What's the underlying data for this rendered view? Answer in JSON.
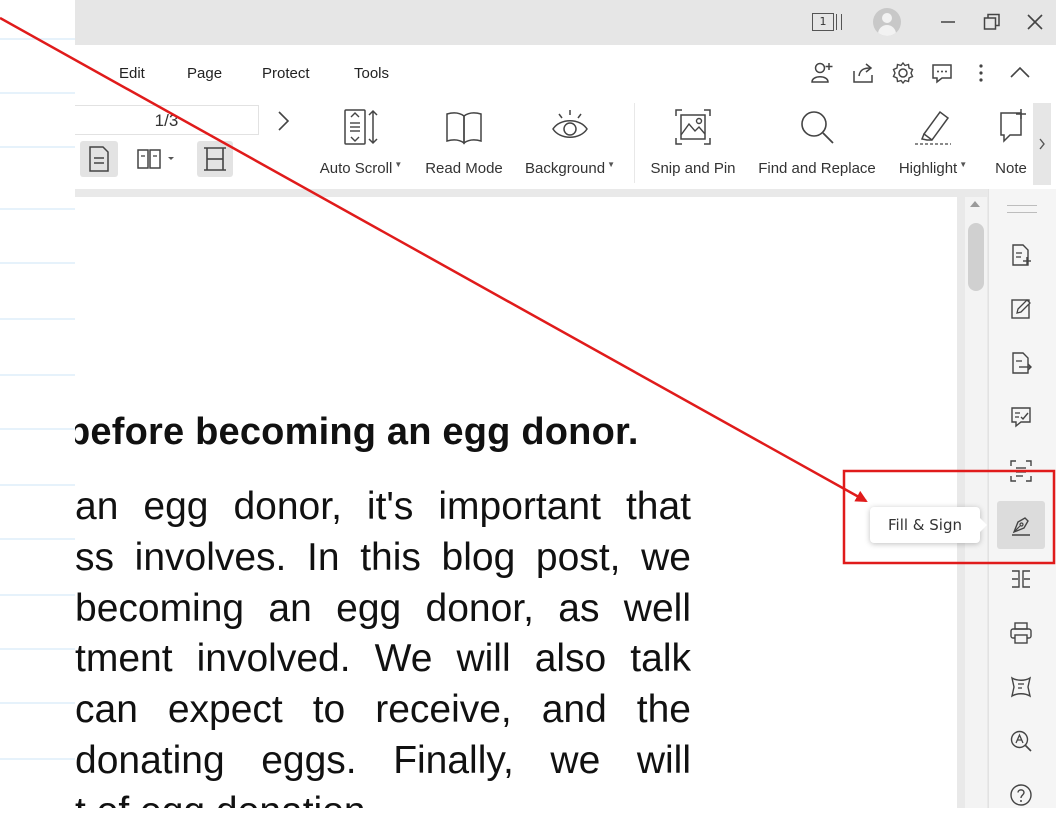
{
  "menu": {
    "items": [
      {
        "label": "Edit"
      },
      {
        "label": "Page"
      },
      {
        "label": "Protect"
      },
      {
        "label": "Tools"
      }
    ]
  },
  "titlebar": {
    "page_count_badge": "1"
  },
  "toolbar": {
    "page_indicator": "1/3",
    "tools": [
      {
        "label": "Auto Scroll",
        "icon": "auto-scroll-icon",
        "has_dropdown": true
      },
      {
        "label": "Read Mode",
        "icon": "book-icon",
        "has_dropdown": false
      },
      {
        "label": "Background",
        "icon": "eye-icon",
        "has_dropdown": true
      },
      {
        "label": "Snip and Pin",
        "icon": "snip-icon",
        "has_dropdown": false
      },
      {
        "label": "Find and Replace",
        "icon": "magnifier-icon",
        "has_dropdown": false
      },
      {
        "label": "Highlight",
        "icon": "highlighter-icon",
        "has_dropdown": true
      },
      {
        "label": "Note",
        "icon": "note-icon",
        "has_dropdown": false
      }
    ]
  },
  "document": {
    "heading": "before becoming an egg donor.",
    "lines": [
      "an egg donor, it's important that",
      "ss involves. In this blog post, we",
      "becoming an egg donor, as well",
      "tment involved. We will also talk",
      "can expect to receive, and the",
      "donating eggs. Finally, we will",
      "t of egg donation."
    ]
  },
  "right_panel": {
    "tooltip": "Fill & Sign",
    "icons": [
      "document-add-icon",
      "edit-document-icon",
      "export-document-icon",
      "form-edit-icon",
      "ocr-scan-icon",
      "fill-sign-icon",
      "compare-icon",
      "print-icon",
      "flatten-icon",
      "search-ai-icon",
      "help-icon"
    ]
  },
  "colors": {
    "annotation_red": "#e01b1b",
    "titlebar_bg": "#e6e6e6",
    "active_button_bg": "#e3e3e3"
  }
}
